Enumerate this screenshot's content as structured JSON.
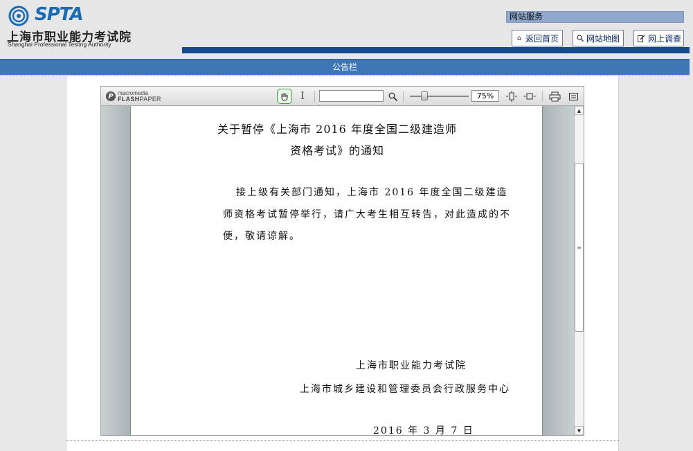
{
  "header": {
    "logo": {
      "word": "SPTA",
      "name_cn": "上海市职业能力考试院",
      "name_en": "Shanghai Professional Testing Authority"
    },
    "service_label": "网站服务",
    "buttons": {
      "home": "返回首页",
      "sitemap": "网站地图",
      "survey": "网上调查"
    },
    "brand_color": "#174a8c"
  },
  "notice_bar": {
    "label": "公告栏",
    "color": "#3f76b5"
  },
  "viewer": {
    "brand_line1": "macromedia",
    "brand_line2_bold": "FLASH",
    "brand_line2_light": "PAPER",
    "search_value": "",
    "zoom": "75%",
    "zoom_slider_fraction": 0.24,
    "tools": [
      "hand-icon",
      "text-select-icon",
      "magnifier-icon",
      "fit-page-icon",
      "fit-width-icon",
      "print-icon",
      "menu-icon"
    ],
    "active_tool": "hand"
  },
  "document": {
    "title_line1": "关于暂停《上海市 2016 年度全国二级建造师",
    "title_line2": "资格考试》的通知",
    "body_line1": "接上级有关部门通知，上海市 2016 年度全国二级建造",
    "body_line2": "师资格考试暂停举行，请广大考生相互转告，对此造成的不",
    "body_line3": "便，敬请谅解。",
    "signature1": "上海市职业能力考试院",
    "signature2": "上海市城乡建设和管理委员会行政服务中心",
    "date": "2016 年 3 月 7 日"
  }
}
